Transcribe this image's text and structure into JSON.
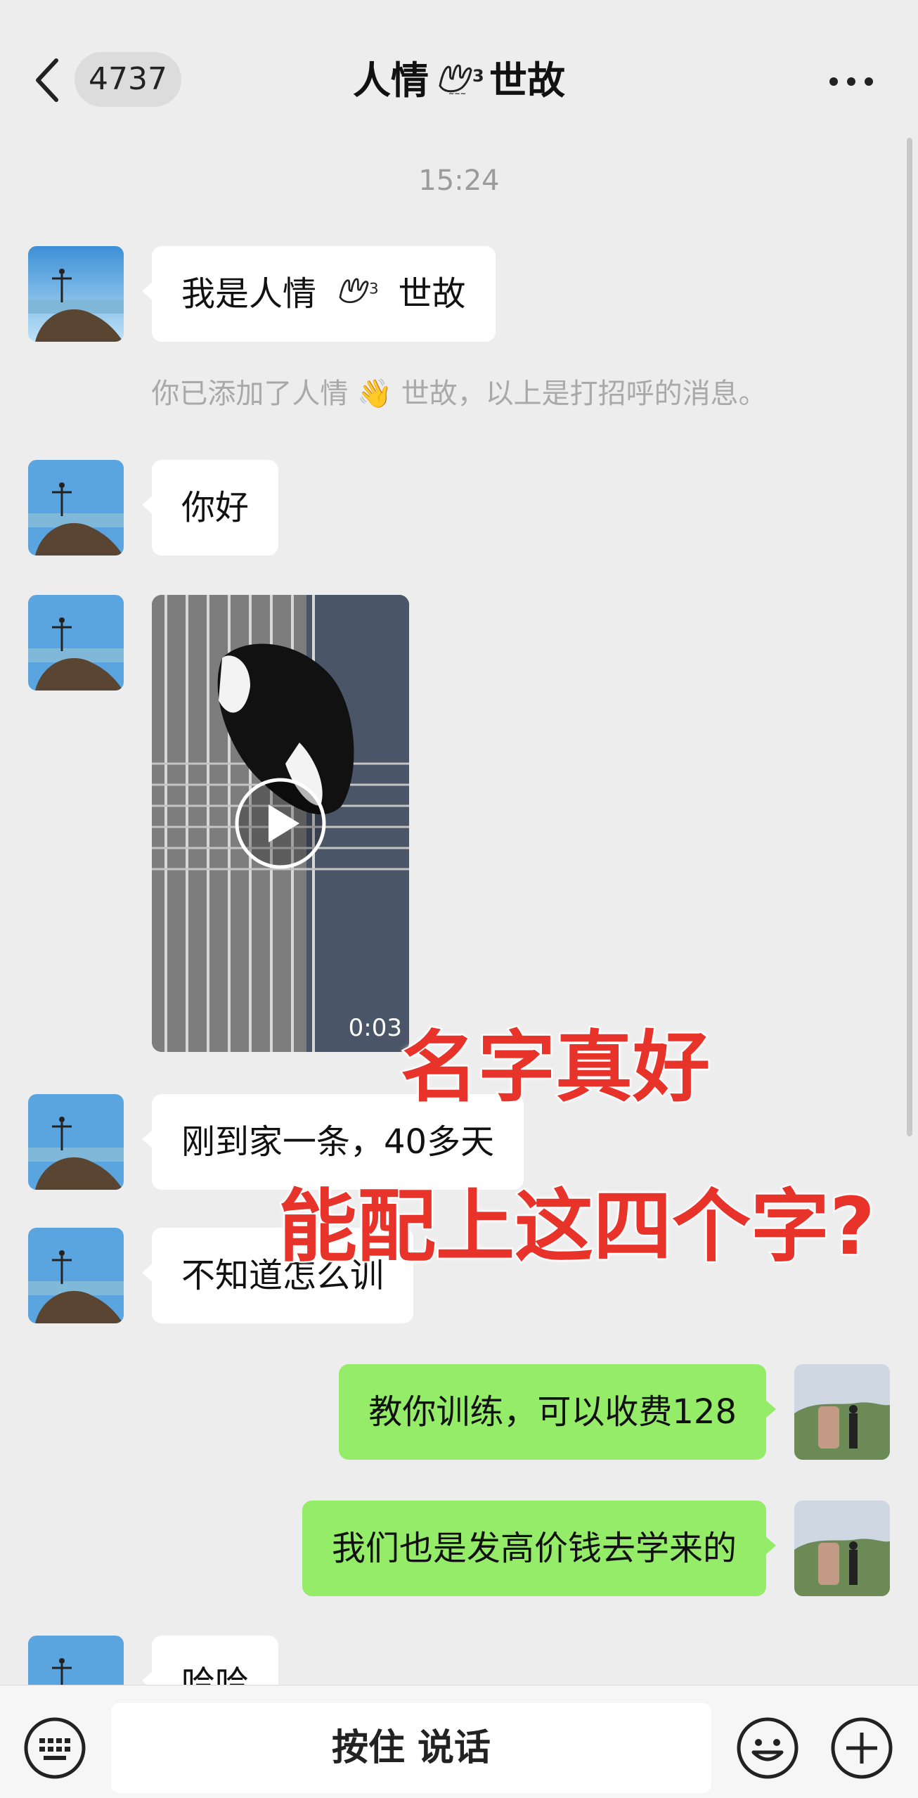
{
  "header": {
    "back_count": "4737",
    "title_left": "人情",
    "title_right": "世故",
    "title_emoji": "hand-emoji-icon",
    "more": "more-icon"
  },
  "chat": {
    "timestamp": "15:24",
    "system_message": "你已添加了人情 👋 世故，以上是打招呼的消息。",
    "messages": [
      {
        "side": "left",
        "text_before": "我是人情",
        "text_after": "世故"
      },
      {
        "side": "left",
        "text": "你好"
      },
      {
        "side": "left",
        "type": "video",
        "duration": "0:03"
      },
      {
        "side": "left",
        "text": "刚到家一条，40多天"
      },
      {
        "side": "left",
        "text": "不知道怎么训"
      },
      {
        "side": "right",
        "text": "教你训练，可以收费128"
      },
      {
        "side": "right",
        "text": "我们也是发高价钱去学来的"
      },
      {
        "side": "left",
        "text": "哈哈"
      }
    ]
  },
  "overlay": {
    "line1": "名字真好",
    "line2": "能配上这四个字?"
  },
  "input_bar": {
    "voice_label": "按住 说话",
    "left_icon": "keyboard-icon",
    "emoji_icon": "emoji-icon",
    "plus_icon": "plus-icon"
  },
  "colors": {
    "background": "#ededed",
    "incoming_bubble": "#ffffff",
    "outgoing_bubble": "#95ec69",
    "overlay_text": "#e8332b"
  }
}
